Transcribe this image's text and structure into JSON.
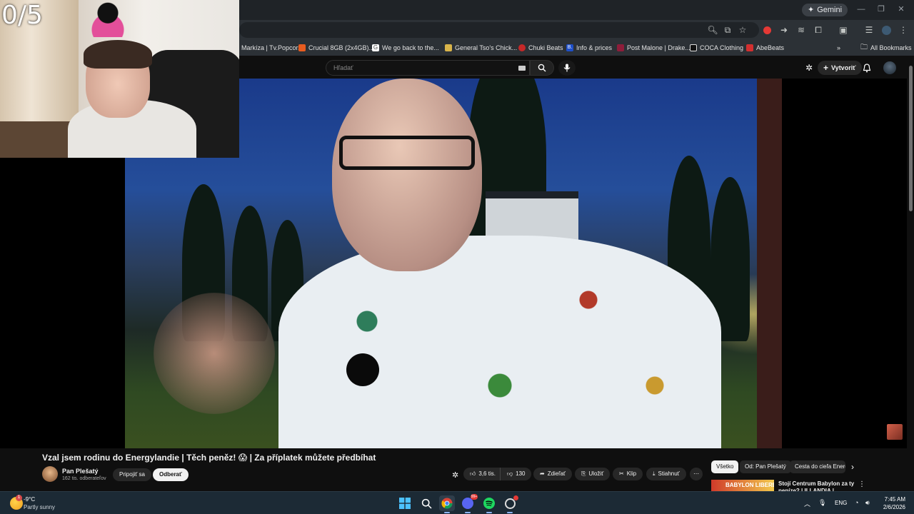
{
  "overlay": {
    "counter": "0/5"
  },
  "browser": {
    "gemini_label": "Gemini",
    "bookmarks": [
      {
        "label": "Markíza | Tv.Popcor...",
        "color": "#2f6fd6"
      },
      {
        "label": "Crucial 8GB (2x4GB)...",
        "color": "#e85c1f"
      },
      {
        "label": "We go back to the...",
        "color": "#ffffff"
      },
      {
        "label": "General Tso's Chick...",
        "color": "#d9b44a"
      },
      {
        "label": "Chuki Beats",
        "color": "#c62828"
      },
      {
        "label": "Info & prices",
        "color": "#1e4fc9"
      },
      {
        "label": "Post Malone | Drake...",
        "color": "#8e1d3a"
      },
      {
        "label": "COCA Clothing",
        "color": "#eeeeee"
      },
      {
        "label": "AbeBeats",
        "color": "#d32f2f"
      }
    ],
    "all_bookmarks": "All Bookmarks"
  },
  "youtube": {
    "search_placeholder": "Hľadať",
    "create_label": "Vytvoriť",
    "video_title": "Vzal jsem rodinu do Energylandie | Těch peněz! 😱 | Za příplatek můžete předbíhat",
    "channel_name": "Pan Plešatý",
    "channel_subs": "162 tis. odberateľov",
    "join_label": "Pripojiť sa",
    "subscribe_label": "Odberať",
    "likes": "3,6 tis.",
    "dislikes": "130",
    "share_label": "Zdieľať",
    "save_label": "Uložiť",
    "clip_label": "Klip",
    "download_label": "Stiahnuť",
    "chips": [
      "Všetko",
      "Od: Pan Plešatý",
      "Cesta do cieľa Energ"
    ],
    "rec_thumb_text": "BABYLON LIBEREC",
    "rec_title": "Stojí Centrum Babylon za ty peníze? | ILLANDIA | Aquapar"
  },
  "taskbar": {
    "temperature": "-9°C",
    "condition": "Partly sunny",
    "language": "ENG",
    "time": "7:45 AM",
    "date": "2/6/2026",
    "weather_badge": "1"
  }
}
